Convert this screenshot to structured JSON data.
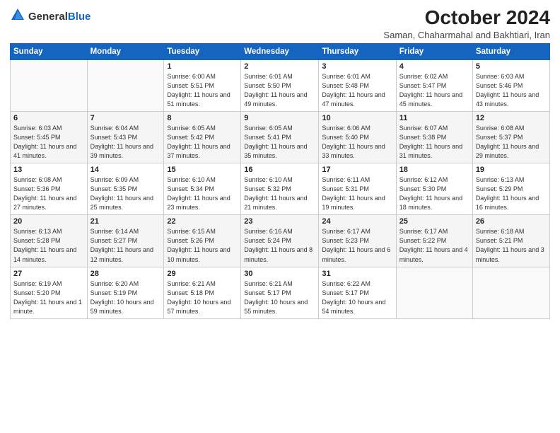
{
  "header": {
    "logo_general": "General",
    "logo_blue": "Blue",
    "title": "October 2024",
    "subtitle": "Saman, Chaharmahal and Bakhtiari, Iran"
  },
  "weekdays": [
    "Sunday",
    "Monday",
    "Tuesday",
    "Wednesday",
    "Thursday",
    "Friday",
    "Saturday"
  ],
  "weeks": [
    [
      {
        "day": "",
        "sunrise": "",
        "sunset": "",
        "daylight": ""
      },
      {
        "day": "",
        "sunrise": "",
        "sunset": "",
        "daylight": ""
      },
      {
        "day": "1",
        "sunrise": "Sunrise: 6:00 AM",
        "sunset": "Sunset: 5:51 PM",
        "daylight": "Daylight: 11 hours and 51 minutes."
      },
      {
        "day": "2",
        "sunrise": "Sunrise: 6:01 AM",
        "sunset": "Sunset: 5:50 PM",
        "daylight": "Daylight: 11 hours and 49 minutes."
      },
      {
        "day": "3",
        "sunrise": "Sunrise: 6:01 AM",
        "sunset": "Sunset: 5:48 PM",
        "daylight": "Daylight: 11 hours and 47 minutes."
      },
      {
        "day": "4",
        "sunrise": "Sunrise: 6:02 AM",
        "sunset": "Sunset: 5:47 PM",
        "daylight": "Daylight: 11 hours and 45 minutes."
      },
      {
        "day": "5",
        "sunrise": "Sunrise: 6:03 AM",
        "sunset": "Sunset: 5:46 PM",
        "daylight": "Daylight: 11 hours and 43 minutes."
      }
    ],
    [
      {
        "day": "6",
        "sunrise": "Sunrise: 6:03 AM",
        "sunset": "Sunset: 5:45 PM",
        "daylight": "Daylight: 11 hours and 41 minutes."
      },
      {
        "day": "7",
        "sunrise": "Sunrise: 6:04 AM",
        "sunset": "Sunset: 5:43 PM",
        "daylight": "Daylight: 11 hours and 39 minutes."
      },
      {
        "day": "8",
        "sunrise": "Sunrise: 6:05 AM",
        "sunset": "Sunset: 5:42 PM",
        "daylight": "Daylight: 11 hours and 37 minutes."
      },
      {
        "day": "9",
        "sunrise": "Sunrise: 6:05 AM",
        "sunset": "Sunset: 5:41 PM",
        "daylight": "Daylight: 11 hours and 35 minutes."
      },
      {
        "day": "10",
        "sunrise": "Sunrise: 6:06 AM",
        "sunset": "Sunset: 5:40 PM",
        "daylight": "Daylight: 11 hours and 33 minutes."
      },
      {
        "day": "11",
        "sunrise": "Sunrise: 6:07 AM",
        "sunset": "Sunset: 5:38 PM",
        "daylight": "Daylight: 11 hours and 31 minutes."
      },
      {
        "day": "12",
        "sunrise": "Sunrise: 6:08 AM",
        "sunset": "Sunset: 5:37 PM",
        "daylight": "Daylight: 11 hours and 29 minutes."
      }
    ],
    [
      {
        "day": "13",
        "sunrise": "Sunrise: 6:08 AM",
        "sunset": "Sunset: 5:36 PM",
        "daylight": "Daylight: 11 hours and 27 minutes."
      },
      {
        "day": "14",
        "sunrise": "Sunrise: 6:09 AM",
        "sunset": "Sunset: 5:35 PM",
        "daylight": "Daylight: 11 hours and 25 minutes."
      },
      {
        "day": "15",
        "sunrise": "Sunrise: 6:10 AM",
        "sunset": "Sunset: 5:34 PM",
        "daylight": "Daylight: 11 hours and 23 minutes."
      },
      {
        "day": "16",
        "sunrise": "Sunrise: 6:10 AM",
        "sunset": "Sunset: 5:32 PM",
        "daylight": "Daylight: 11 hours and 21 minutes."
      },
      {
        "day": "17",
        "sunrise": "Sunrise: 6:11 AM",
        "sunset": "Sunset: 5:31 PM",
        "daylight": "Daylight: 11 hours and 19 minutes."
      },
      {
        "day": "18",
        "sunrise": "Sunrise: 6:12 AM",
        "sunset": "Sunset: 5:30 PM",
        "daylight": "Daylight: 11 hours and 18 minutes."
      },
      {
        "day": "19",
        "sunrise": "Sunrise: 6:13 AM",
        "sunset": "Sunset: 5:29 PM",
        "daylight": "Daylight: 11 hours and 16 minutes."
      }
    ],
    [
      {
        "day": "20",
        "sunrise": "Sunrise: 6:13 AM",
        "sunset": "Sunset: 5:28 PM",
        "daylight": "Daylight: 11 hours and 14 minutes."
      },
      {
        "day": "21",
        "sunrise": "Sunrise: 6:14 AM",
        "sunset": "Sunset: 5:27 PM",
        "daylight": "Daylight: 11 hours and 12 minutes."
      },
      {
        "day": "22",
        "sunrise": "Sunrise: 6:15 AM",
        "sunset": "Sunset: 5:26 PM",
        "daylight": "Daylight: 11 hours and 10 minutes."
      },
      {
        "day": "23",
        "sunrise": "Sunrise: 6:16 AM",
        "sunset": "Sunset: 5:24 PM",
        "daylight": "Daylight: 11 hours and 8 minutes."
      },
      {
        "day": "24",
        "sunrise": "Sunrise: 6:17 AM",
        "sunset": "Sunset: 5:23 PM",
        "daylight": "Daylight: 11 hours and 6 minutes."
      },
      {
        "day": "25",
        "sunrise": "Sunrise: 6:17 AM",
        "sunset": "Sunset: 5:22 PM",
        "daylight": "Daylight: 11 hours and 4 minutes."
      },
      {
        "day": "26",
        "sunrise": "Sunrise: 6:18 AM",
        "sunset": "Sunset: 5:21 PM",
        "daylight": "Daylight: 11 hours and 3 minutes."
      }
    ],
    [
      {
        "day": "27",
        "sunrise": "Sunrise: 6:19 AM",
        "sunset": "Sunset: 5:20 PM",
        "daylight": "Daylight: 11 hours and 1 minute."
      },
      {
        "day": "28",
        "sunrise": "Sunrise: 6:20 AM",
        "sunset": "Sunset: 5:19 PM",
        "daylight": "Daylight: 10 hours and 59 minutes."
      },
      {
        "day": "29",
        "sunrise": "Sunrise: 6:21 AM",
        "sunset": "Sunset: 5:18 PM",
        "daylight": "Daylight: 10 hours and 57 minutes."
      },
      {
        "day": "30",
        "sunrise": "Sunrise: 6:21 AM",
        "sunset": "Sunset: 5:17 PM",
        "daylight": "Daylight: 10 hours and 55 minutes."
      },
      {
        "day": "31",
        "sunrise": "Sunrise: 6:22 AM",
        "sunset": "Sunset: 5:17 PM",
        "daylight": "Daylight: 10 hours and 54 minutes."
      },
      {
        "day": "",
        "sunrise": "",
        "sunset": "",
        "daylight": ""
      },
      {
        "day": "",
        "sunrise": "",
        "sunset": "",
        "daylight": ""
      }
    ]
  ]
}
